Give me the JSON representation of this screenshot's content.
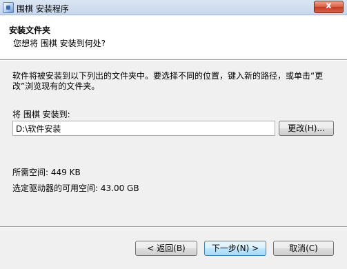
{
  "window": {
    "title": "围棋 安装程序",
    "close_label": "x"
  },
  "header": {
    "title": "安装文件夹",
    "subtitle": "您想将 围棋 安装到何处?"
  },
  "body": {
    "description": "软件将被安装到以下列出的文件夹中。要选择不同的位置，键入新的路径，或单击“更改”浏览现有的文件夹。",
    "dest_label": "将 围棋 安装到:",
    "path_value": "D:\\软件安装",
    "browse_label": "更改(H)...",
    "required_space": "所需空间: 449 KB",
    "available_space": "选定驱动器的可用空间: 43.00 GB"
  },
  "buttons": {
    "back": "< 返回(B)",
    "next": "下一步(N) >",
    "cancel": "取消(C)"
  }
}
